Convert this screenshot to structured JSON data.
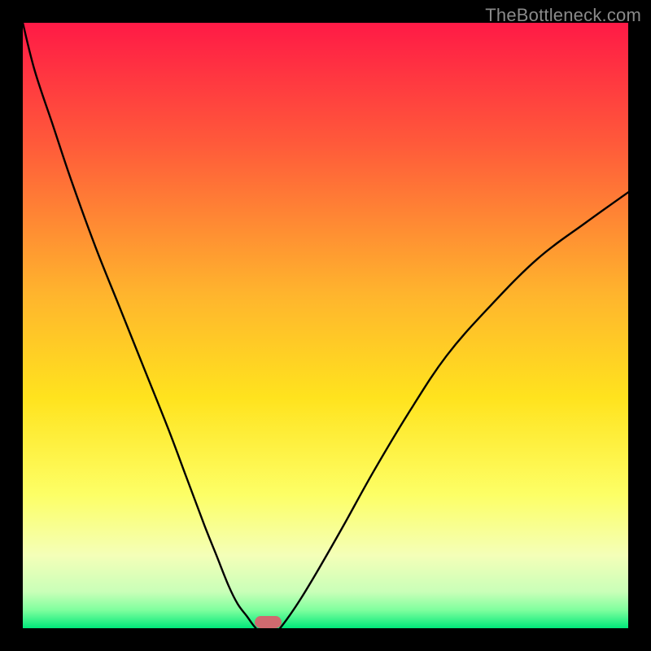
{
  "watermark": "TheBottleneck.com",
  "chart_data": {
    "type": "line",
    "title": "",
    "xlabel": "",
    "ylabel": "",
    "xlim": [
      0,
      100
    ],
    "ylim": [
      0,
      100
    ],
    "grid": false,
    "legend": false,
    "gradient_stops": [
      {
        "pos": 0.0,
        "color": "#ff1a46"
      },
      {
        "pos": 0.2,
        "color": "#ff5a3a"
      },
      {
        "pos": 0.45,
        "color": "#ffb52d"
      },
      {
        "pos": 0.62,
        "color": "#ffe31e"
      },
      {
        "pos": 0.78,
        "color": "#fdff66"
      },
      {
        "pos": 0.88,
        "color": "#f4ffb8"
      },
      {
        "pos": 0.94,
        "color": "#c9ffb8"
      },
      {
        "pos": 0.97,
        "color": "#7fff9e"
      },
      {
        "pos": 1.0,
        "color": "#00e87a"
      }
    ],
    "series": [
      {
        "name": "left",
        "x": [
          0,
          2,
          5,
          8,
          12,
          16,
          20,
          24,
          27,
          30,
          32,
          34,
          35.5,
          37,
          38,
          38.5
        ],
        "y": [
          100,
          92,
          83,
          74,
          63,
          53,
          43,
          33,
          25,
          17,
          12,
          7,
          4,
          2,
          0.6,
          0
        ]
      },
      {
        "name": "right",
        "x": [
          42.5,
          44,
          46,
          49,
          53,
          58,
          64,
          70,
          77,
          85,
          93,
          100
        ],
        "y": [
          0,
          2,
          5,
          10,
          17,
          26,
          36,
          45,
          53,
          61,
          67,
          72
        ]
      }
    ],
    "marker": {
      "x": 40.5,
      "y": 0,
      "width": 4.5,
      "height": 2,
      "color": "#cf6a6f"
    }
  }
}
